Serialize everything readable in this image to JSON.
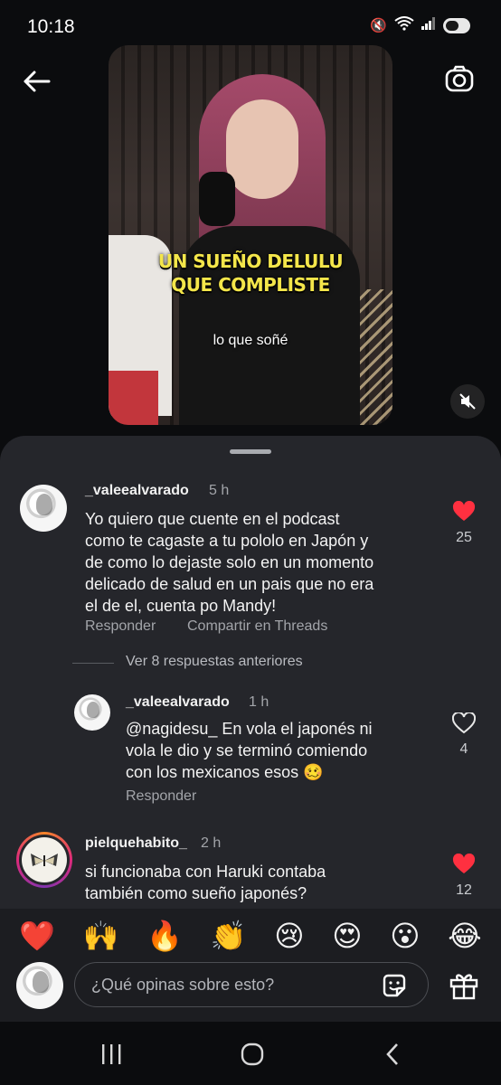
{
  "status_bar": {
    "time": "10:18"
  },
  "video": {
    "caption_line1": "UN SUEÑO DELULU",
    "caption_line2": "QUE COMPLISTE",
    "subtitle": "lo que soñé"
  },
  "comments": [
    {
      "username": "_valeealvarado",
      "time": "5 h",
      "lines": [
        "Yo quiero que cuente en el podcast",
        "como te cagaste a tu pololo en Japón y",
        "de como lo dejaste solo en un momento",
        "delicado de salud en un pais que no era",
        "el de el, cuenta po Mandy!"
      ],
      "likes": "25",
      "liked": true,
      "reply_label": "Responder",
      "share_label": "Compartir en Threads"
    }
  ],
  "view_more_replies": "Ver 8 respuestas anteriores",
  "reply": {
    "username": "_valeealvarado",
    "time": "1 h",
    "lines": [
      "@nagidesu_ En vola el japonés ni",
      "vola le dio y se terminó comiendo",
      "con los mexicanos esos 🥴"
    ],
    "likes": "4",
    "liked": false,
    "reply_label": "Responder"
  },
  "comment2": {
    "username": "pielquehabito_",
    "time": "2 h",
    "lines": [
      "si funcionaba con Haruki contaba",
      "también como sueño japonés?"
    ],
    "likes": "12",
    "liked": true
  },
  "emojis": [
    "❤️",
    "🙌",
    "🔥",
    "👏",
    "😢",
    "😍",
    "😮",
    "😂"
  ],
  "composer": {
    "placeholder": "¿Qué opinas sobre esto?"
  },
  "colors": {
    "like_red": "#ff3040",
    "sheet_bg": "#25262b",
    "caption_yellow": "#f4e64a"
  },
  "icons": {
    "back": "arrow-left-icon",
    "camera": "camera-icon",
    "mute": "speaker-muted-icon",
    "sticker": "sticker-icon",
    "gift": "gift-icon"
  }
}
